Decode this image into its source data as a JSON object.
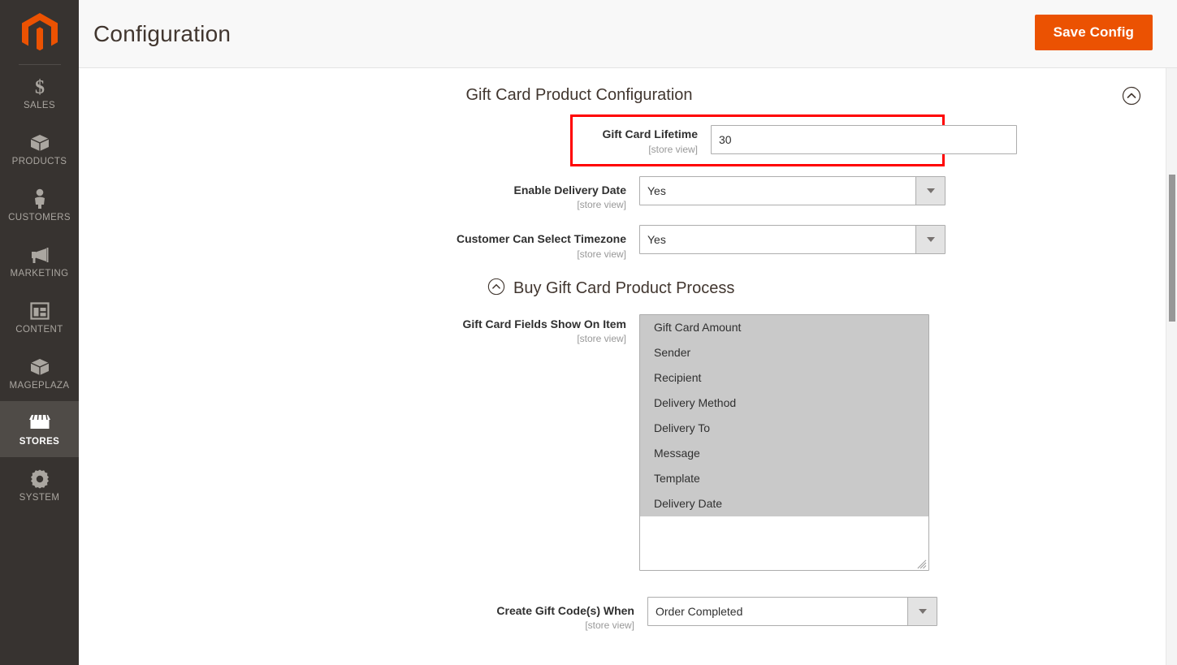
{
  "sidebar": {
    "logo": {
      "icon": "magento-logo-icon",
      "color": "#eb5202"
    },
    "items": [
      {
        "label": "SALES",
        "icon": "dollar-sign-icon",
        "active": false
      },
      {
        "label": "PRODUCTS",
        "icon": "box-icon",
        "active": false
      },
      {
        "label": "CUSTOMERS",
        "icon": "person-icon",
        "active": false
      },
      {
        "label": "MARKETING",
        "icon": "megaphone-icon",
        "active": false
      },
      {
        "label": "CONTENT",
        "icon": "layout-panel-icon",
        "active": false
      },
      {
        "label": "MAGEPLAZA",
        "icon": "box-icon",
        "active": false
      },
      {
        "label": "STORES",
        "icon": "storefront-icon",
        "active": true
      },
      {
        "label": "SYSTEM",
        "icon": "gear-icon",
        "active": false
      }
    ]
  },
  "header": {
    "title": "Configuration",
    "save_label": "Save Config",
    "save_color": "#eb5202"
  },
  "section": {
    "title": "Gift Card Product Configuration",
    "collapse_icon": "chevron-up-circle-icon"
  },
  "fields": {
    "gift_card_lifetime": {
      "label": "Gift Card Lifetime",
      "scope": "[store view]",
      "value": "30",
      "highlight_color": "#ff0000"
    },
    "enable_delivery_date": {
      "label": "Enable Delivery Date",
      "scope": "[store view]",
      "value": "Yes"
    },
    "customer_can_select_timezone": {
      "label": "Customer Can Select Timezone",
      "scope": "[store view]",
      "value": "Yes"
    },
    "gift_card_fields_show_on_item": {
      "label": "Gift Card Fields Show On Item",
      "scope": "[store view]",
      "options": [
        {
          "label": "Gift Card Amount",
          "selected": true
        },
        {
          "label": "Sender",
          "selected": true
        },
        {
          "label": "Recipient",
          "selected": true
        },
        {
          "label": "Delivery Method",
          "selected": true
        },
        {
          "label": "Delivery To",
          "selected": true
        },
        {
          "label": "Message",
          "selected": true
        },
        {
          "label": "Template",
          "selected": true
        },
        {
          "label": "Delivery Date",
          "selected": true
        }
      ]
    },
    "create_gift_codes_when": {
      "label": "Create Gift Code(s) When",
      "scope": "[store view]",
      "value": "Order Completed"
    }
  },
  "subsection": {
    "title": "Buy Gift Card Product Process",
    "collapse_icon": "chevron-up-circle-icon"
  }
}
